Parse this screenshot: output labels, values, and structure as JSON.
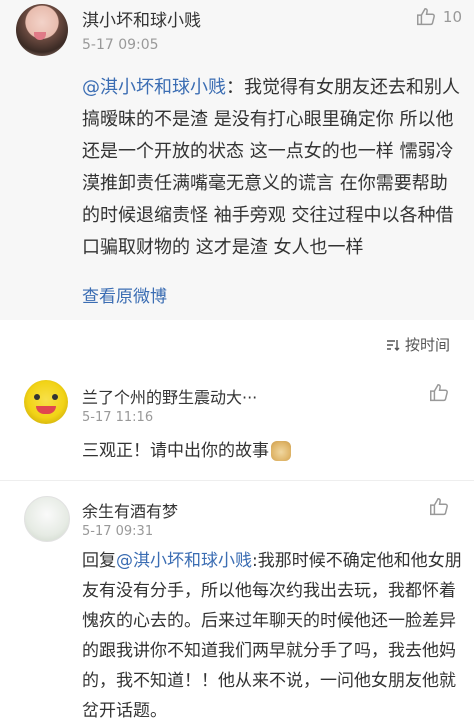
{
  "repost": {
    "username": "淇小坏和球小贱",
    "time": "5-17 09:05",
    "like_count": "10",
    "mention": "@淇小坏和球小贱",
    "text": "：我觉得有女朋友还去和别人搞暧昧的不是渣 是没有打心眼里确定你 所以他还是一个开放的状态 这一点女的也一样 懦弱冷漠推卸责任满嘴毫无意义的谎言 在你需要帮助的时候退缩责怪 袖手旁观 交往过程中以各种借口骗取财物的 这才是渣 女人也一样",
    "view_original": "查看原微博"
  },
  "sort": {
    "label": "按时间"
  },
  "comments": [
    {
      "username": "兰了个州的野生震动大···",
      "time": "5-17 11:16",
      "text": "三观正！请中出你的故事",
      "emoji": "doge-emoji"
    },
    {
      "username": "余生有酒有梦",
      "time": "5-17 09:31",
      "reply_prefix": "回复",
      "mention": "@淇小坏和球小贱",
      "text": ":我那时候不确定他和他女朋友有没有分手，所以他每次约我出去玩，我都怀着愧疚的心去的。后来过年聊天的时候他还一脸差异的跟我讲你不知道我们两早就分手了吗，我去他妈的，我不知道！！他从来不说，一问他女朋友他就岔开话题。"
    }
  ],
  "icons": {
    "like": "thumbs-up-icon",
    "sort": "sort-icon"
  },
  "colors": {
    "link": "#3b6db3",
    "meta": "#999999",
    "card_bg": "#f7f7f7"
  }
}
